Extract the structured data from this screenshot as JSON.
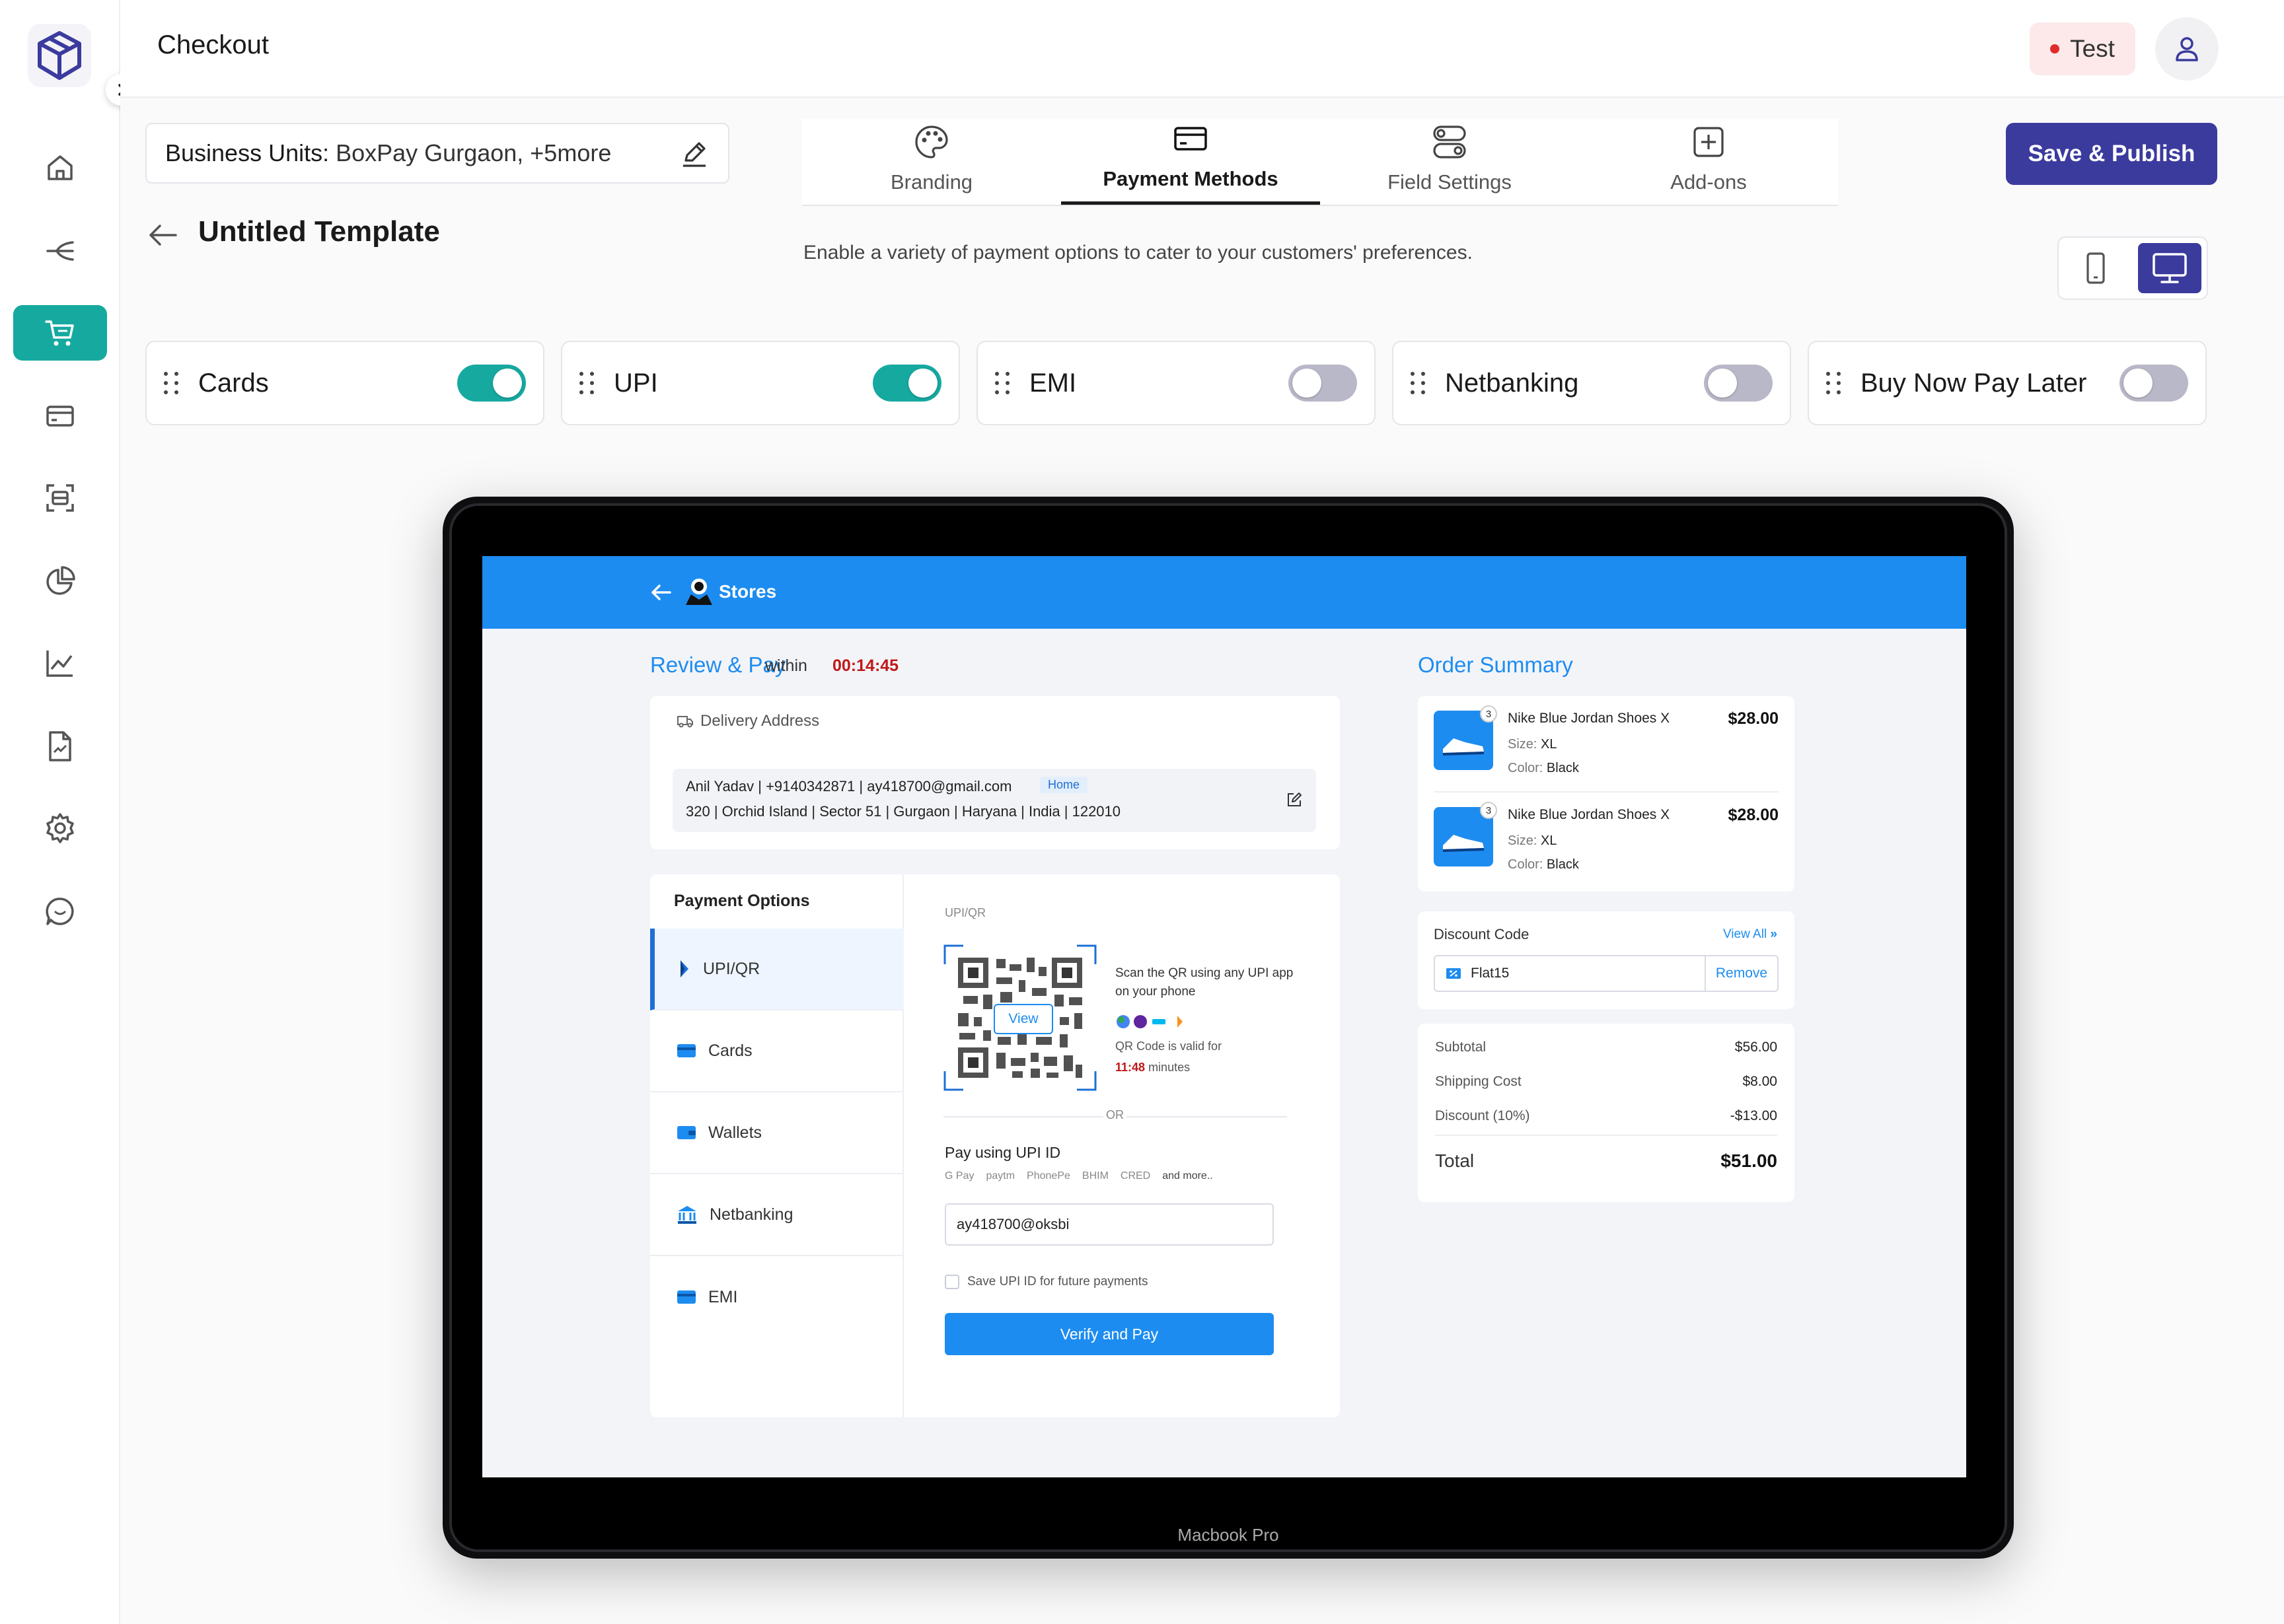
{
  "page": {
    "title": "Checkout"
  },
  "topbar": {
    "env_badge": "Test"
  },
  "sidebar": {
    "items": [
      {
        "icon": "home-icon"
      },
      {
        "icon": "flow-icon"
      },
      {
        "icon": "cart-icon",
        "active": true
      },
      {
        "icon": "card-icon"
      },
      {
        "icon": "scan-icon"
      },
      {
        "icon": "pie-chart-icon"
      },
      {
        "icon": "line-chart-icon"
      },
      {
        "icon": "report-icon"
      },
      {
        "icon": "settings-icon"
      },
      {
        "icon": "chat-icon"
      }
    ]
  },
  "business_units": {
    "label": "Business Units:",
    "value": "BoxPay Gurgaon, +5more"
  },
  "tabs": [
    {
      "label": "Branding",
      "icon": "palette-icon"
    },
    {
      "label": "Payment Methods",
      "icon": "card-icon",
      "active": true
    },
    {
      "label": "Field Settings",
      "icon": "toggles-icon"
    },
    {
      "label": "Add-ons",
      "icon": "plus-square-icon"
    }
  ],
  "actions": {
    "save_publish": "Save & Publish"
  },
  "template": {
    "title": "Untitled Template"
  },
  "subtitle": "Enable a variety of payment options to cater to your customers' preferences.",
  "device_toggle": {
    "selected": "desktop"
  },
  "payment_methods": [
    {
      "label": "Cards",
      "enabled": true
    },
    {
      "label": "UPI",
      "enabled": true
    },
    {
      "label": "EMI",
      "enabled": false
    },
    {
      "label": "Netbanking",
      "enabled": false
    },
    {
      "label": "Buy Now Pay Later",
      "enabled": false
    }
  ],
  "preview": {
    "device_label": "Macbook Pro",
    "store_name": "Stores",
    "review_title": "Review & Pay",
    "within": "within",
    "timer": "00:14:45",
    "delivery": {
      "heading": "Delivery Address",
      "line1": "Anil Yadav | +9140342871 | ay418700@gmail.com",
      "tag": "Home",
      "line2": "320 | Orchid Island | Sector 51 | Gurgaon | Haryana | India | 122010"
    },
    "payment_options": {
      "heading": "Payment Options",
      "items": [
        {
          "label": "UPI/QR",
          "active": true
        },
        {
          "label": "Cards"
        },
        {
          "label": "Wallets"
        },
        {
          "label": "Netbanking"
        },
        {
          "label": "EMI"
        }
      ]
    },
    "upi": {
      "section_label": "UPI/QR",
      "view_btn": "View",
      "scan_text": "Scan the QR using any UPI app on your phone",
      "valid_text": "QR Code is valid for",
      "valid_time": "11:48",
      "valid_unit": "minutes",
      "or": "OR",
      "upi_id_heading": "Pay using UPI ID",
      "apps": [
        "G Pay",
        "paytm",
        "PhonePe",
        "BHIM",
        "CRED",
        "and more.."
      ],
      "upi_id_value": "ay418700@oksbi",
      "save_label": "Save UPI ID for future payments",
      "verify_btn": "Verify and Pay"
    },
    "order_summary": {
      "heading": "Order Summary",
      "items": [
        {
          "qty": "3",
          "name": "Nike Blue Jordan Shoes X",
          "price": "$28.00",
          "size_label": "Size:",
          "size": "XL",
          "color_label": "Color:",
          "color": "Black"
        },
        {
          "qty": "3",
          "name": "Nike Blue Jordan Shoes X",
          "price": "$28.00",
          "size_label": "Size:",
          "size": "XL",
          "color_label": "Color:",
          "color": "Black"
        }
      ]
    },
    "discount": {
      "heading": "Discount Code",
      "view_all": "View All",
      "code": "Flat15",
      "remove": "Remove"
    },
    "totals": {
      "subtotal_label": "Subtotal",
      "subtotal": "$56.00",
      "shipping_label": "Shipping Cost",
      "shipping": "$8.00",
      "discount_label": "Discount (10%)",
      "discount": "-$13.00",
      "total_label": "Total",
      "total": "$51.00"
    }
  },
  "colors": {
    "accent": "#16a9a0",
    "primary": "#3b3b9e",
    "preview_blue": "#1d8cf0"
  }
}
